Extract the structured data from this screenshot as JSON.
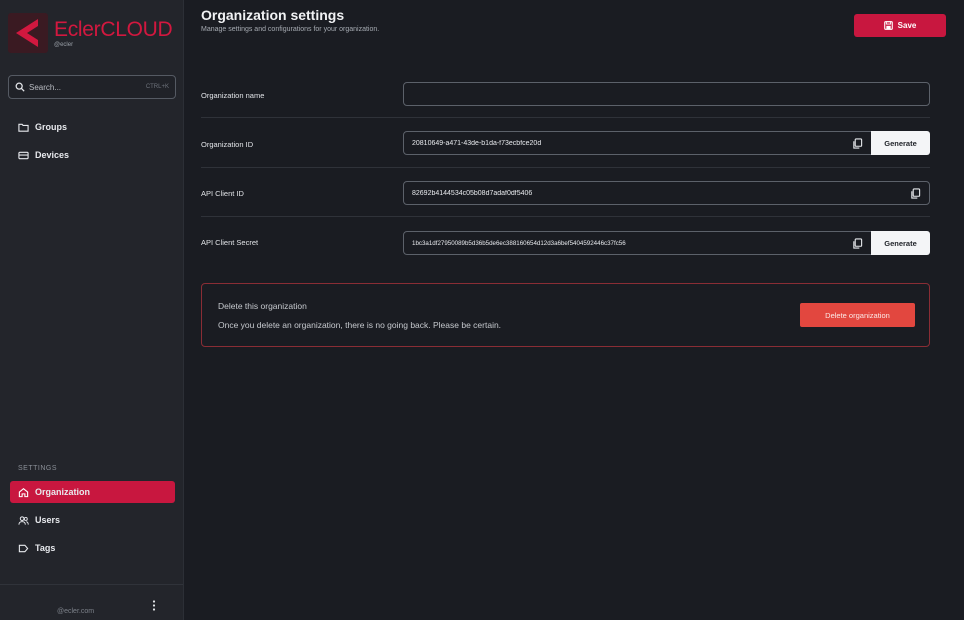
{
  "brand": {
    "name": "EclerCLOUD",
    "sub": "@ecler",
    "color": "#d2183f"
  },
  "sidebar": {
    "search_placeholder": "Search...",
    "search_shortcut": "CTRL+K",
    "items": [
      {
        "label": "Groups",
        "icon": "folder-icon"
      },
      {
        "label": "Devices",
        "icon": "devices-icon"
      }
    ],
    "settings_label": "SETTINGS",
    "settings_items": [
      {
        "label": "Organization",
        "icon": "home-icon",
        "active": true
      },
      {
        "label": "Users",
        "icon": "users-icon"
      },
      {
        "label": "Tags",
        "icon": "tag-icon"
      }
    ],
    "footer_email": "@ecler.com"
  },
  "header": {
    "title": "Organization settings",
    "subtitle": "Manage settings and configurations for your organization.",
    "save_label": "Save"
  },
  "form": {
    "org_name": {
      "label": "Organization name",
      "value": ""
    },
    "org_id": {
      "label": "Organization ID",
      "value": "20810649-a471-43de-b1da-f73ecbfce20d",
      "button": "Generate"
    },
    "api_client_id": {
      "label": "API Client ID",
      "value": "82692b4144534c05b08d7adaf0df5406"
    },
    "api_client_secret": {
      "label": "API Client Secret",
      "value": "1bc3a1df27950089b5d36b5de6ec388160654d12d3a6bef5404592446c37fc56",
      "button": "Generate"
    }
  },
  "danger": {
    "title": "Delete this organization",
    "description": "Once you delete an organization, there is no going back. Please be certain.",
    "button": "Delete organization"
  },
  "colors": {
    "accent": "#c8173f",
    "danger_button": "#e2473f",
    "danger_border": "#8a2d35",
    "background": "#1a1c22",
    "sidebar": "#23252b"
  }
}
